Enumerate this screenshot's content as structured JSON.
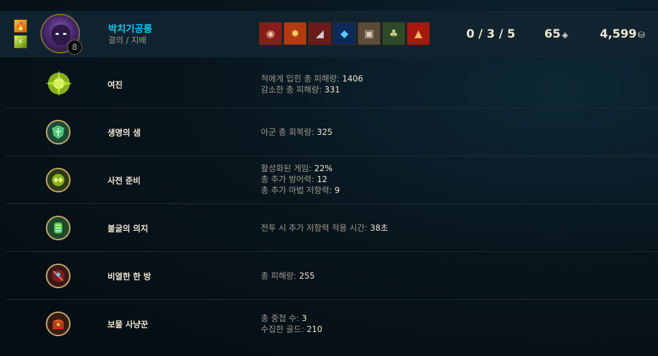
{
  "header": {
    "summoner_spells": [
      {
        "name": "ignite-spell-icon",
        "glyph": "🔥"
      },
      {
        "name": "flash-spell-icon",
        "glyph": "⚡"
      }
    ],
    "champion_level": "8",
    "player_name": "박치기공룡",
    "rune_trees": "결의 / 지배",
    "items": [
      {
        "icon": "cloak-item-icon",
        "glyph": "◉",
        "color": "#8a1c1c"
      },
      {
        "icon": "flame-item-icon",
        "glyph": "✹",
        "color": "#b53a10"
      },
      {
        "icon": "boots-item-icon",
        "glyph": "◢",
        "color": "#6a1a1a"
      },
      {
        "icon": "ward-item-icon",
        "glyph": "◆",
        "color": "#1c5cc8"
      },
      {
        "icon": "armor-item-icon",
        "glyph": "▣",
        "color": "#5a4a3a"
      },
      {
        "icon": "heart-item-icon",
        "glyph": "♣",
        "color": "#2f6a3a"
      },
      {
        "icon": "sunfire-item-icon",
        "glyph": "▲",
        "color": "#a81810"
      }
    ],
    "kda": "0 / 3 / 5",
    "cs": "65",
    "gold": "4,599"
  },
  "runes": [
    {
      "name": "여진",
      "icon": "aftershock-rune-icon",
      "stats": [
        {
          "label": "적에게 입힌 총 피해량:",
          "value": "1406"
        },
        {
          "label": "감소한 총 피해량:",
          "value": "331"
        }
      ]
    },
    {
      "name": "생명의 샘",
      "icon": "font-of-life-rune-icon",
      "stats": [
        {
          "label": "아군 총 회복량:",
          "value": "325"
        }
      ]
    },
    {
      "name": "사전 준비",
      "icon": "conditioning-rune-icon",
      "stats": [
        {
          "label": "활성화된 게임:",
          "value": "22%"
        },
        {
          "label": "총 추가 방어력:",
          "value": "12"
        },
        {
          "label": "총 추가 마법 저항력:",
          "value": "9"
        }
      ]
    },
    {
      "name": "불굴의 의지",
      "icon": "unflinching-rune-icon",
      "stats": [
        {
          "label": "전투 시 추가 저항력 적용 시간:",
          "value": "38초"
        }
      ]
    },
    {
      "name": "비열한 한 방",
      "icon": "cheap-shot-rune-icon",
      "stats": [
        {
          "label": "총 피해량:",
          "value": "255"
        }
      ]
    },
    {
      "name": "보물 사냥꾼",
      "icon": "treasure-hunter-rune-icon",
      "stats": [
        {
          "label": "총 중첩 수:",
          "value": "3"
        },
        {
          "label": "수집한 골드:",
          "value": "210"
        }
      ]
    }
  ]
}
